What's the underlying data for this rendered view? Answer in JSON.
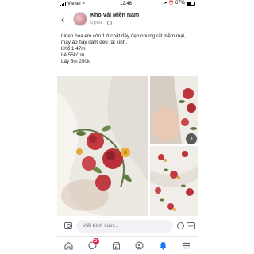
{
  "status_bar": {
    "carrier": "Viettel",
    "time": "12:46",
    "battery": "67%"
  },
  "header": {
    "page_name": "Kho Vải Miền Nam",
    "timestamp": "9 phút"
  },
  "post": {
    "lines": [
      "Linen hoa em còn 1 ít chất dầy đẹp nhưng rất mềm mại,  may áo hay đầm đều rất xinh.",
      "Khổ 1,47m",
      "Lẻ 55k/1m",
      "Lấy 5m 250k"
    ]
  },
  "comment_bar": {
    "placeholder": "Viết bình luận..."
  },
  "tabbar": {
    "notification_badge": "2"
  },
  "colors": {
    "accent": "#1877f2",
    "badge": "#e41e3f",
    "icon_gray": "#606770"
  }
}
